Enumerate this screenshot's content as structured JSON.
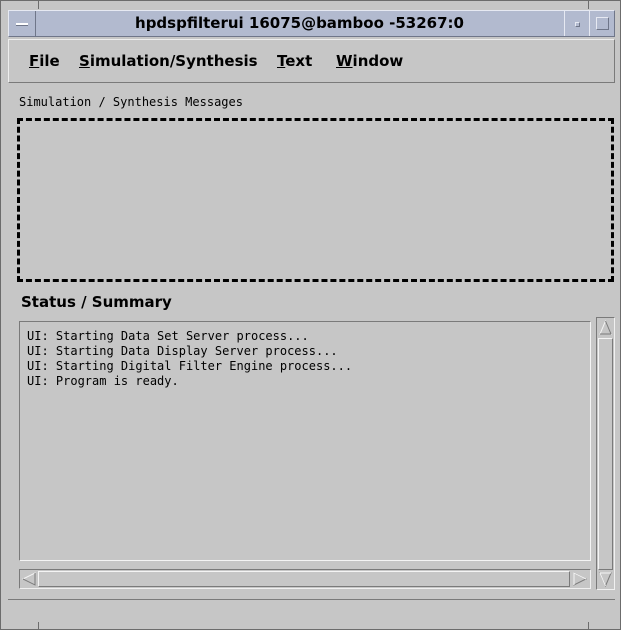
{
  "window": {
    "title": "hpdspfilterui 16075@bamboo -53267:0"
  },
  "menubar": {
    "items": [
      {
        "label": "File",
        "mnemonic": "F"
      },
      {
        "label": "Simulation/Synthesis",
        "mnemonic": "S"
      },
      {
        "label": "Text",
        "mnemonic": "T"
      },
      {
        "label": "Window",
        "mnemonic": "W"
      }
    ]
  },
  "messages": {
    "label": "Simulation / Synthesis Messages",
    "content": ""
  },
  "status": {
    "heading": "Status / Summary",
    "lines": [
      "UI: Starting Data Set Server process...",
      "UI: Starting Data Display Server process...",
      "UI: Starting Digital Filter Engine process...",
      "UI: Program is ready."
    ]
  },
  "colors": {
    "background": "#c6c6c6",
    "titlebar": "#b2bacf",
    "dashed_border": "#000000"
  }
}
